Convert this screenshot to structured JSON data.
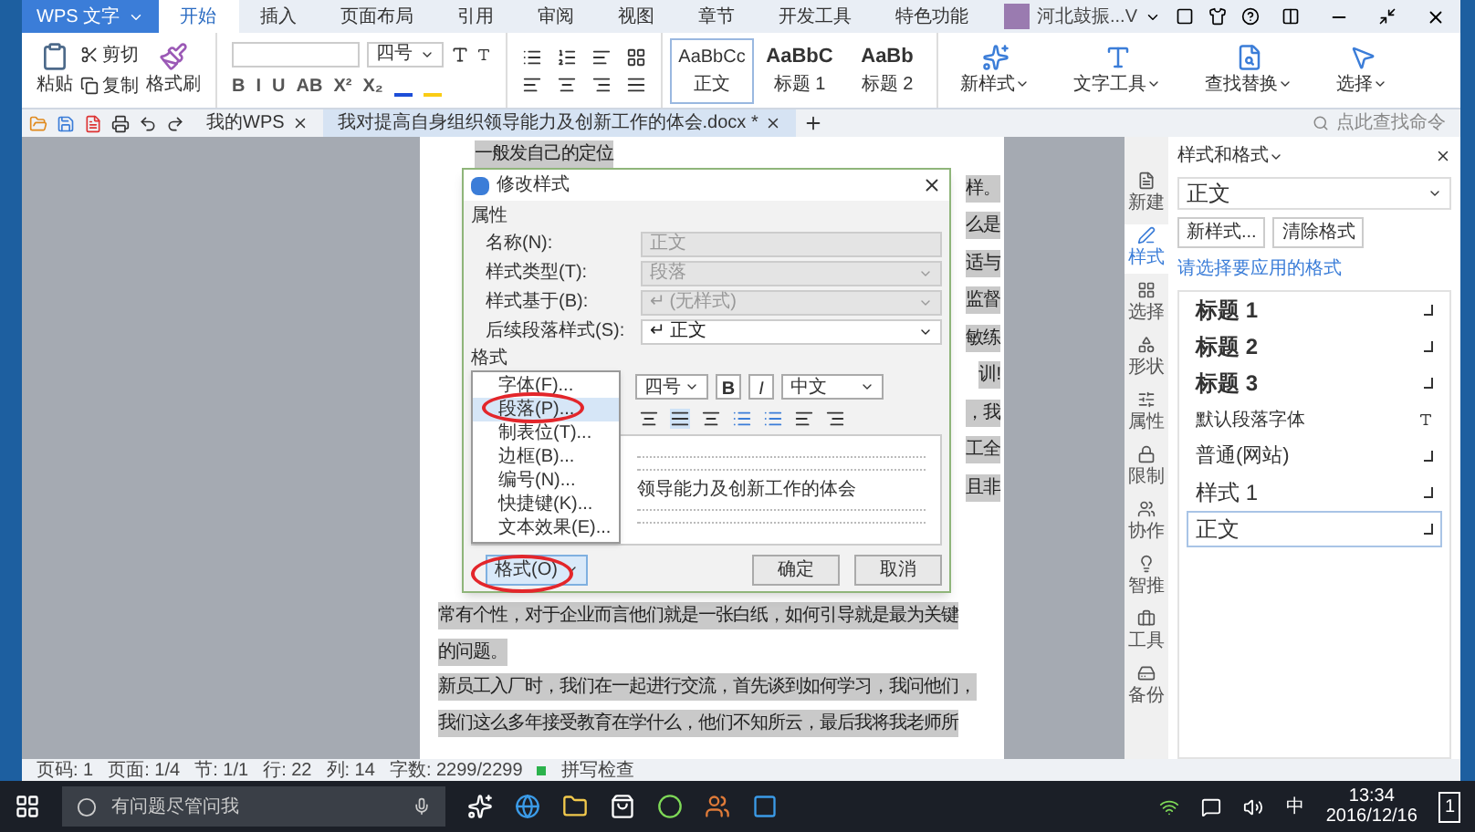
{
  "app_menu": {
    "label": "WPS 文字"
  },
  "ribbon_tabs": [
    {
      "label": "开始",
      "selected": true
    },
    {
      "label": "插入",
      "selected": false
    },
    {
      "label": "页面布局",
      "selected": false
    },
    {
      "label": "引用",
      "selected": false
    },
    {
      "label": "审阅",
      "selected": false
    },
    {
      "label": "视图",
      "selected": false
    },
    {
      "label": "章节",
      "selected": false
    },
    {
      "label": "开发工具",
      "selected": false
    },
    {
      "label": "特色功能",
      "selected": false
    }
  ],
  "account": {
    "name": "河北鼓振...V"
  },
  "ribbon": {
    "paste": "粘贴",
    "cut": "剪切",
    "copy": "复制",
    "format_painter": "格式刷",
    "font_size": "四号",
    "font_buttons": [
      "B",
      "I",
      "U",
      "AB",
      "X²",
      "X₂"
    ],
    "styles": [
      {
        "sample": "AaBbCc",
        "name": "正文",
        "selected": true
      },
      {
        "sample": "AaBbC",
        "name": "标题 1",
        "selected": false
      },
      {
        "sample": "AaBb",
        "name": "标题 2",
        "selected": false
      }
    ],
    "tools": [
      "新样式",
      "文字工具",
      "查找替换",
      "选择"
    ]
  },
  "doc_tabs": [
    {
      "label": "我的WPS",
      "selected": false
    },
    {
      "label": "我对提高自身组织领导能力及创新工作的体会.docx *",
      "selected": true
    }
  ],
  "command_search": {
    "placeholder": "点此查找命令"
  },
  "document": {
    "lines": [
      {
        "kind": "left",
        "text": "一般发自己的定位"
      },
      {
        "kind": "right",
        "text": "样。"
      },
      {
        "kind": "right",
        "text": "么是"
      },
      {
        "kind": "right",
        "text": "适与"
      },
      {
        "kind": "right",
        "text": "监督"
      },
      {
        "kind": "right",
        "text": "敏练"
      },
      {
        "kind": "right",
        "text": "训!"
      },
      {
        "kind": "right",
        "text": "，我"
      },
      {
        "kind": "right",
        "text": "工全"
      },
      {
        "kind": "right",
        "text": "且非"
      },
      {
        "kind": "full",
        "text": "常有个性，对于企业而言他们就是一张白纸，如何引导就是最为关键"
      },
      {
        "kind": "full",
        "text": "的问题。"
      },
      {
        "kind": "full",
        "text": "新员工入厂时，我们在一起进行交流，首先谈到如何学习，我问他们，"
      },
      {
        "kind": "full",
        "text": "我们这么多年接受教育在学什么，他们不知所云，最后我将我老师所"
      }
    ]
  },
  "dialog": {
    "title": "修改样式",
    "properties_heading": "属性",
    "fields": [
      {
        "label": "名称(N):",
        "value": "正文",
        "kind": "text",
        "disabled": true
      },
      {
        "label": "样式类型(T):",
        "value": "段落",
        "kind": "select",
        "disabled": true
      },
      {
        "label": "样式基于(B):",
        "value": "↵ (无样式)",
        "kind": "select",
        "disabled": true
      },
      {
        "label": "后续段落样式(S):",
        "value": "↵ 正文",
        "kind": "select",
        "disabled": false
      }
    ],
    "format_heading": "格式",
    "font_size": "四号",
    "bold": "B",
    "italic": "I",
    "script": "中文",
    "preview_text": "领导能力及创新工作的体会",
    "menu": [
      {
        "label": "字体(F)...",
        "selected": false
      },
      {
        "label": "段落(P)...",
        "selected": true
      },
      {
        "label": "制表位(T)...",
        "selected": false
      },
      {
        "label": "边框(B)...",
        "selected": false
      },
      {
        "label": "编号(N)...",
        "selected": false
      },
      {
        "label": "快捷键(K)...",
        "selected": false
      },
      {
        "label": "文本效果(E)...",
        "selected": false
      }
    ],
    "format_button": "格式(O)",
    "ok": "确定",
    "cancel": "取消"
  },
  "sidebar": [
    {
      "label": "新建",
      "selected": false
    },
    {
      "label": "样式",
      "selected": true
    },
    {
      "label": "选择",
      "selected": false
    },
    {
      "label": "形状",
      "selected": false
    },
    {
      "label": "属性",
      "selected": false
    },
    {
      "label": "限制",
      "selected": false
    },
    {
      "label": "协作",
      "selected": false
    },
    {
      "label": "智推",
      "selected": false
    },
    {
      "label": "工具",
      "selected": false
    },
    {
      "label": "备份",
      "selected": false
    }
  ],
  "style_panel": {
    "title": "样式和格式",
    "current": "正文",
    "buttons": [
      "新样式...",
      "清除格式"
    ],
    "prompt": "请选择要应用的格式",
    "styles": [
      {
        "label": "标题 1",
        "kind": "heading",
        "selected": false
      },
      {
        "label": "标题 2",
        "kind": "heading",
        "selected": false
      },
      {
        "label": "标题 3",
        "kind": "heading",
        "selected": false
      },
      {
        "label": "默认段落字体",
        "kind": "character",
        "selected": false
      },
      {
        "label": "普通(网站)",
        "kind": "normal",
        "selected": false
      },
      {
        "label": "样式 1",
        "kind": "large",
        "selected": false
      },
      {
        "label": "正文",
        "kind": "large",
        "selected": true
      }
    ]
  },
  "status_bar": {
    "items": [
      "页码: 1",
      "页面: 1/4",
      "节: 1/1",
      "行: 22",
      "列: 14",
      "字数: 2299/2299"
    ],
    "spell_check": {
      "label": "拼写检查",
      "on": true
    }
  },
  "taskbar": {
    "search_placeholder": "有问题尽管问我",
    "ime": "中",
    "time": "13:34",
    "date": "2016/12/16",
    "notifications": "1"
  }
}
